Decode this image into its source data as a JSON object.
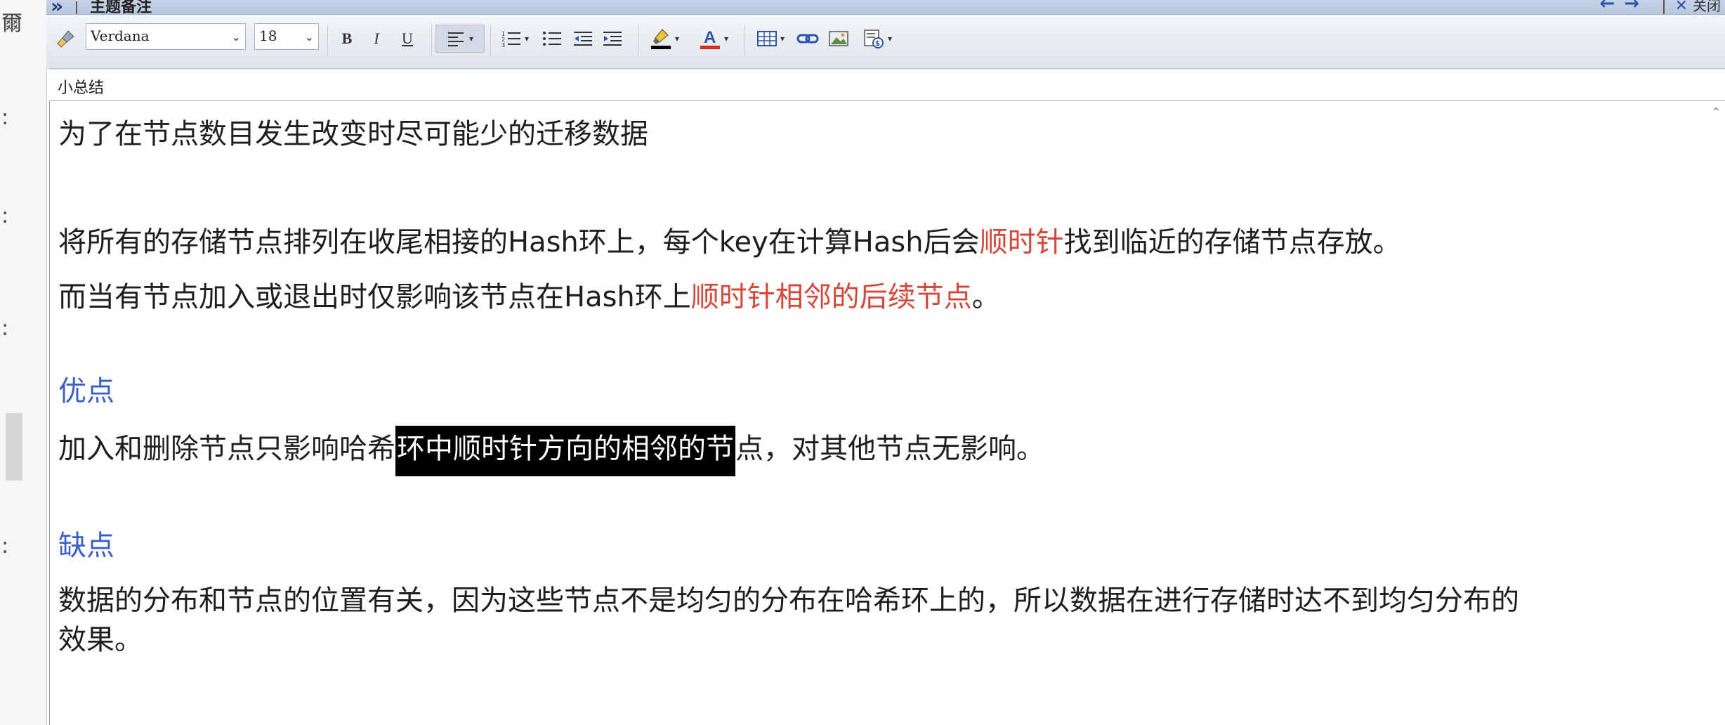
{
  "title_bar": {
    "expand_glyph": "»",
    "title": "主题备注",
    "nav_arrows": "← →",
    "close_glyph": "✕",
    "close_text": "关闭"
  },
  "toolbar": {
    "font_name": "Verdana",
    "font_size": "18",
    "bold_label": "B",
    "italic_label": "I",
    "underline_label": "U",
    "highlight_color": "#000000",
    "font_color": "#d8271e"
  },
  "subject": {
    "label": "小总结"
  },
  "content": {
    "line1": "为了在节点数目发生改变时尽可能少的迁移数据",
    "para2_part1": "将所有的存储节点排列在收尾相接的Hash环上，每个key在计算Hash后会",
    "para2_red": "顺时针",
    "para2_part2": "找到临近的存储节点存放。",
    "para3_part1": "而当有节点加入或退出时仅影响该节点在Hash环上",
    "para3_red": "顺时针相邻的后续节点",
    "para3_part2": "。",
    "pros_heading": "优点",
    "pros_part1": "加入和删除节点只影响哈希",
    "pros_highlight": "环中顺时针方向的相邻的节",
    "pros_part2": "点，对其他节点无影响。",
    "cons_heading": "缺点",
    "cons_line1": "数据的分布和节点的位置有关，因为这些节点不是均匀的分布在哈希环上的，所以数据在进行存储时达不到均匀分布的",
    "cons_line2": "效果。"
  },
  "colors": {
    "accent_red": "#d4473a",
    "heading_blue": "#3b5fc9",
    "selection_bg": "#000000"
  }
}
